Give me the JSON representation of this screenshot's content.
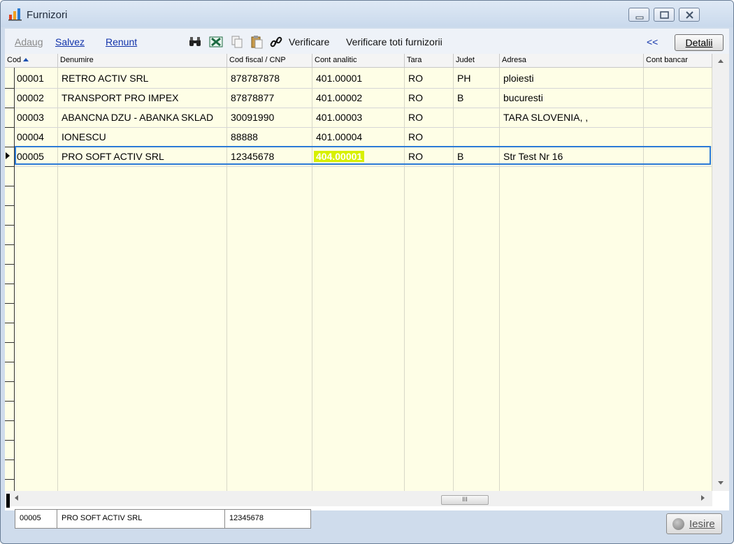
{
  "window": {
    "title": "Furnizori"
  },
  "toolbar": {
    "add_label": "Adaug",
    "save_label": "Salvez",
    "cancel_label": "Renunt",
    "verify_label": "Verificare",
    "verify_all_label": "Verificare toti furnizorii",
    "collapse_label": "<<",
    "details_label": "Detalii"
  },
  "grid": {
    "sort_column": "Cod",
    "columns": [
      {
        "key": "cod",
        "label": "Cod"
      },
      {
        "key": "denumire",
        "label": "Denumire"
      },
      {
        "key": "cod_fiscal",
        "label": "Cod fiscal / CNP"
      },
      {
        "key": "cont_analitic",
        "label": "Cont analitic"
      },
      {
        "key": "tara",
        "label": "Tara"
      },
      {
        "key": "judet",
        "label": "Judet"
      },
      {
        "key": "adresa",
        "label": "Adresa"
      },
      {
        "key": "cont_bancar",
        "label": "Cont bancar"
      }
    ],
    "rows": [
      {
        "cod": "00001",
        "denumire": "RETRO ACTIV SRL",
        "cod_fiscal": "878787878",
        "cont_analitic": "401.00001",
        "tara": "RO",
        "judet": "PH",
        "adresa": "ploiesti",
        "cont_bancar": ""
      },
      {
        "cod": "00002",
        "denumire": "TRANSPORT PRO IMPEX",
        "cod_fiscal": "87878877",
        "cont_analitic": "401.00002",
        "tara": "RO",
        "judet": "B",
        "adresa": "bucuresti",
        "cont_bancar": ""
      },
      {
        "cod": "00003",
        "denumire": "ABANCNA DZU - ABANKA SKLAD",
        "cod_fiscal": "30091990",
        "cont_analitic": "401.00003",
        "tara": "RO",
        "judet": "",
        "adresa": "TARA SLOVENIA, ,",
        "cont_bancar": ""
      },
      {
        "cod": "00004",
        "denumire": "IONESCU",
        "cod_fiscal": "88888",
        "cont_analitic": "401.00004",
        "tara": "RO",
        "judet": "",
        "adresa": "",
        "cont_bancar": ""
      },
      {
        "cod": "00005",
        "denumire": "PRO SOFT ACTIV SRL",
        "cod_fiscal": "12345678",
        "cont_analitic": "404.00001",
        "tara": "RO",
        "judet": "B",
        "adresa": "Str Test Nr 16",
        "cont_bancar": ""
      }
    ],
    "selected_row": 4,
    "scroll_thumb_label": "III"
  },
  "footer": {
    "cod": "00005",
    "denumire": "PRO SOFT ACTIV SRL",
    "cod_fiscal": "12345678",
    "exit_label": "Iesire"
  },
  "colors": {
    "highlight": "#d8f000",
    "selection_border": "#2b7ad6",
    "grid_background": "#fefee6"
  }
}
